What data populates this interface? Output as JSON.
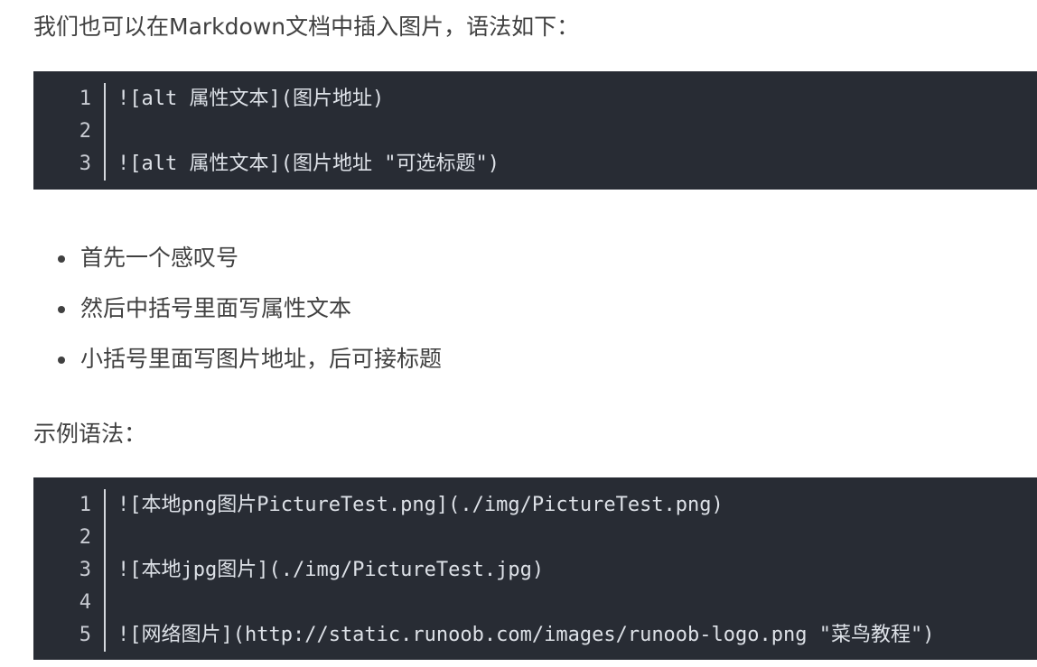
{
  "intro_text": "我们也可以在Markdown文档中插入图片，语法如下：",
  "syntax_code": {
    "lines": [
      {
        "number": "1",
        "code": "![alt 属性文本](图片地址)"
      },
      {
        "number": "2",
        "code": ""
      },
      {
        "number": "3",
        "code": "![alt 属性文本](图片地址 \"可选标题\")"
      }
    ]
  },
  "bullets": [
    "首先一个感叹号",
    "然后中括号里面写属性文本",
    "小括号里面写图片地址，后可接标题"
  ],
  "example_label": "示例语法：",
  "example_code": {
    "lines": [
      {
        "number": "1",
        "code": "![本地png图片PictureTest.png](./img/PictureTest.png)"
      },
      {
        "number": "2",
        "code": ""
      },
      {
        "number": "3",
        "code": "![本地jpg图片](./img/PictureTest.jpg)"
      },
      {
        "number": "4",
        "code": ""
      },
      {
        "number": "5",
        "code": "![网络图片](http://static.runoob.com/images/runoob-logo.png \"菜鸟教程\")"
      }
    ]
  },
  "colors": {
    "code_background": "#282c34",
    "code_text": "#dde1e7",
    "body_text": "#404040"
  }
}
